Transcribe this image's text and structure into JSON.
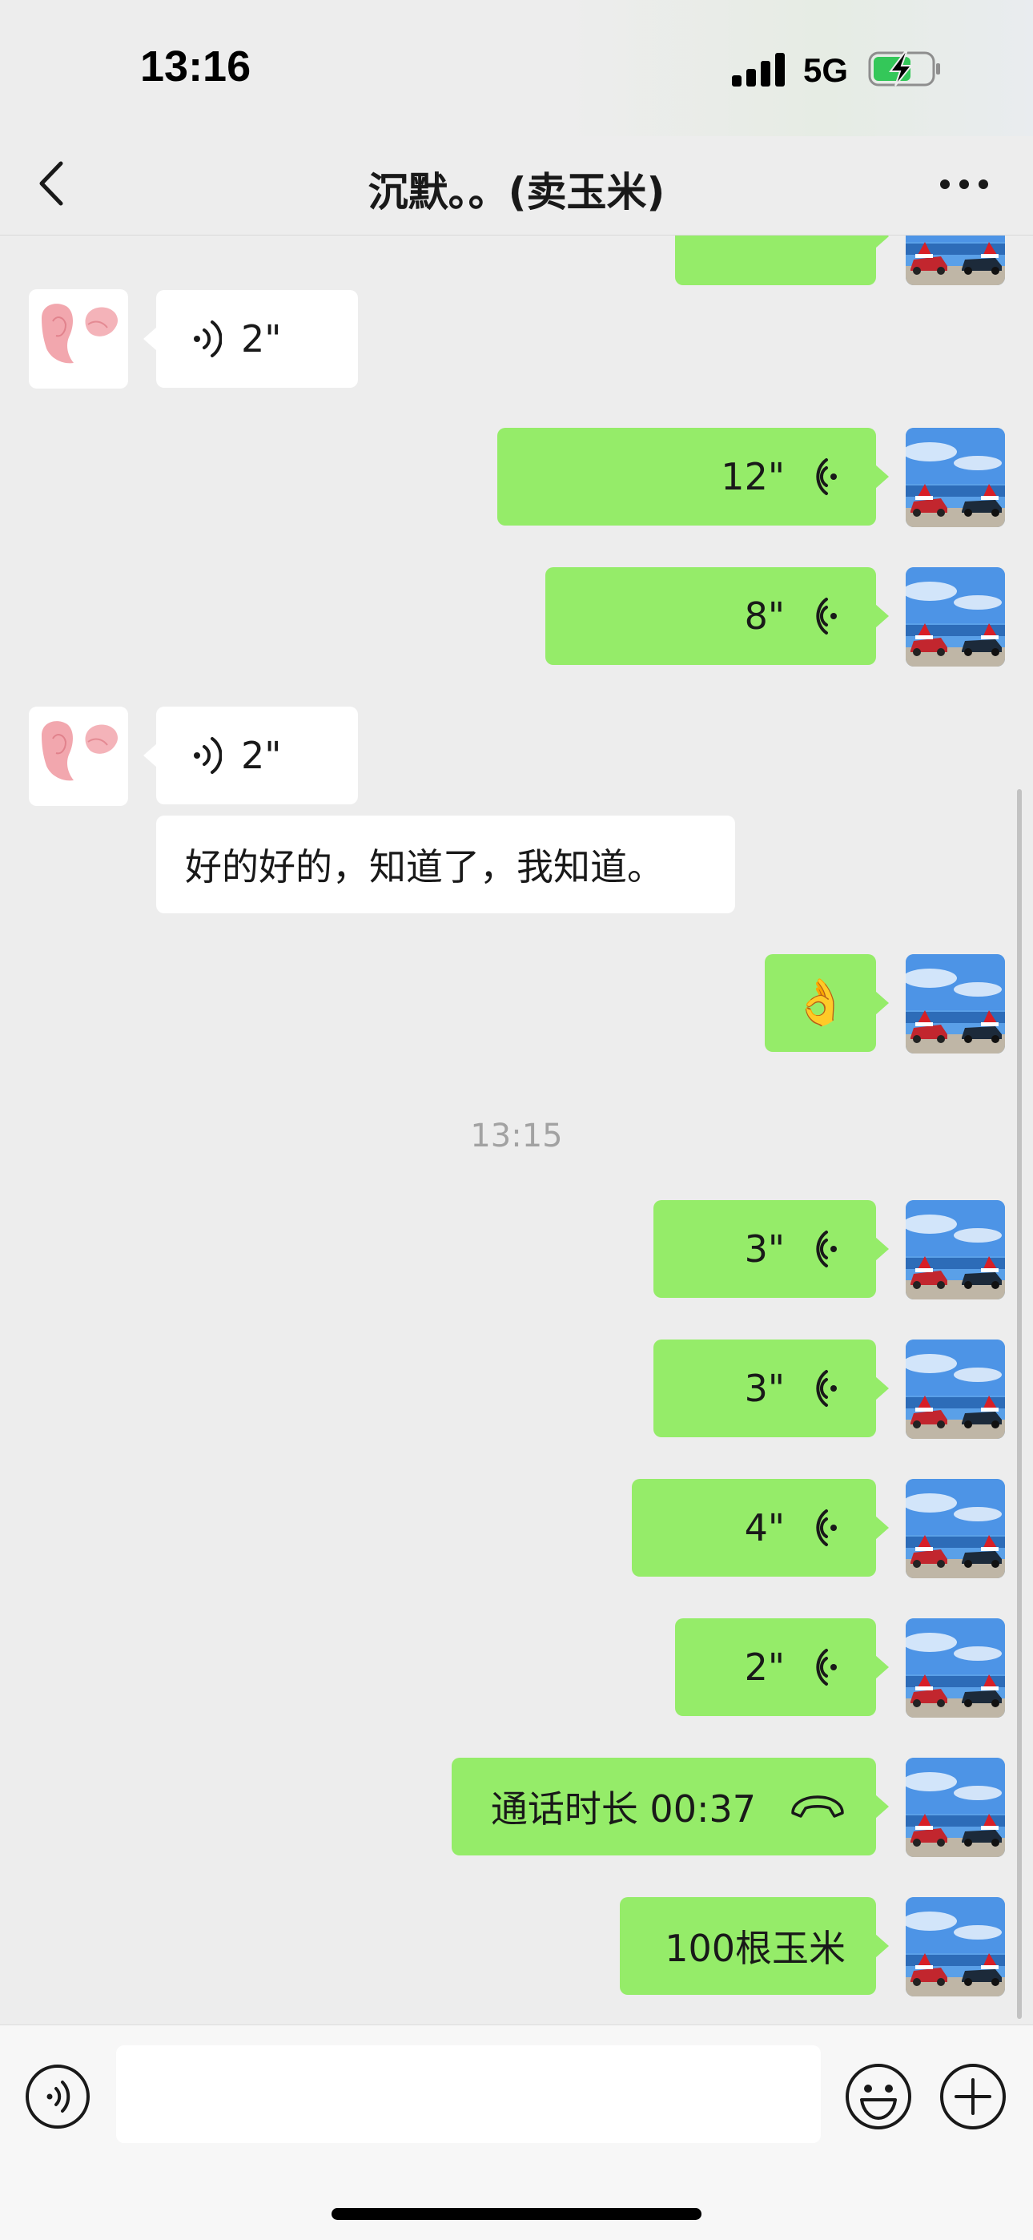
{
  "status_bar": {
    "time": "13:16",
    "network": "5G"
  },
  "nav": {
    "title": "沉默。。(卖玉米)"
  },
  "messages": {
    "m1": {
      "text": "2\""
    },
    "m2": {
      "text": "12\""
    },
    "m3": {
      "text": "8\""
    },
    "m4": {
      "text": "2\""
    },
    "m5": {
      "text": "好的好的，知道了，我知道。"
    },
    "m6": {
      "text": "👌"
    },
    "m7": {
      "text": "3\""
    },
    "m8": {
      "text": "3\""
    },
    "m9": {
      "text": "4\""
    },
    "m10": {
      "text": "2\""
    },
    "m11": {
      "text": "通话时长 00:37"
    },
    "m12": {
      "text": "100根玉米"
    }
  },
  "timestamp": "13:15",
  "input": {
    "value": ""
  },
  "icons": {
    "back": "chevron-left-icon",
    "more": "more-dots-icon",
    "voice_toggle": "voice-icon",
    "emoji": "emoji-icon",
    "plus": "plus-icon",
    "voice_message": "voice-wave-icon",
    "call": "phone-hangup-icon"
  },
  "colors": {
    "background": "#ededed",
    "outgoing_bubble": "#95ec69",
    "incoming_bubble": "#ffffff"
  }
}
